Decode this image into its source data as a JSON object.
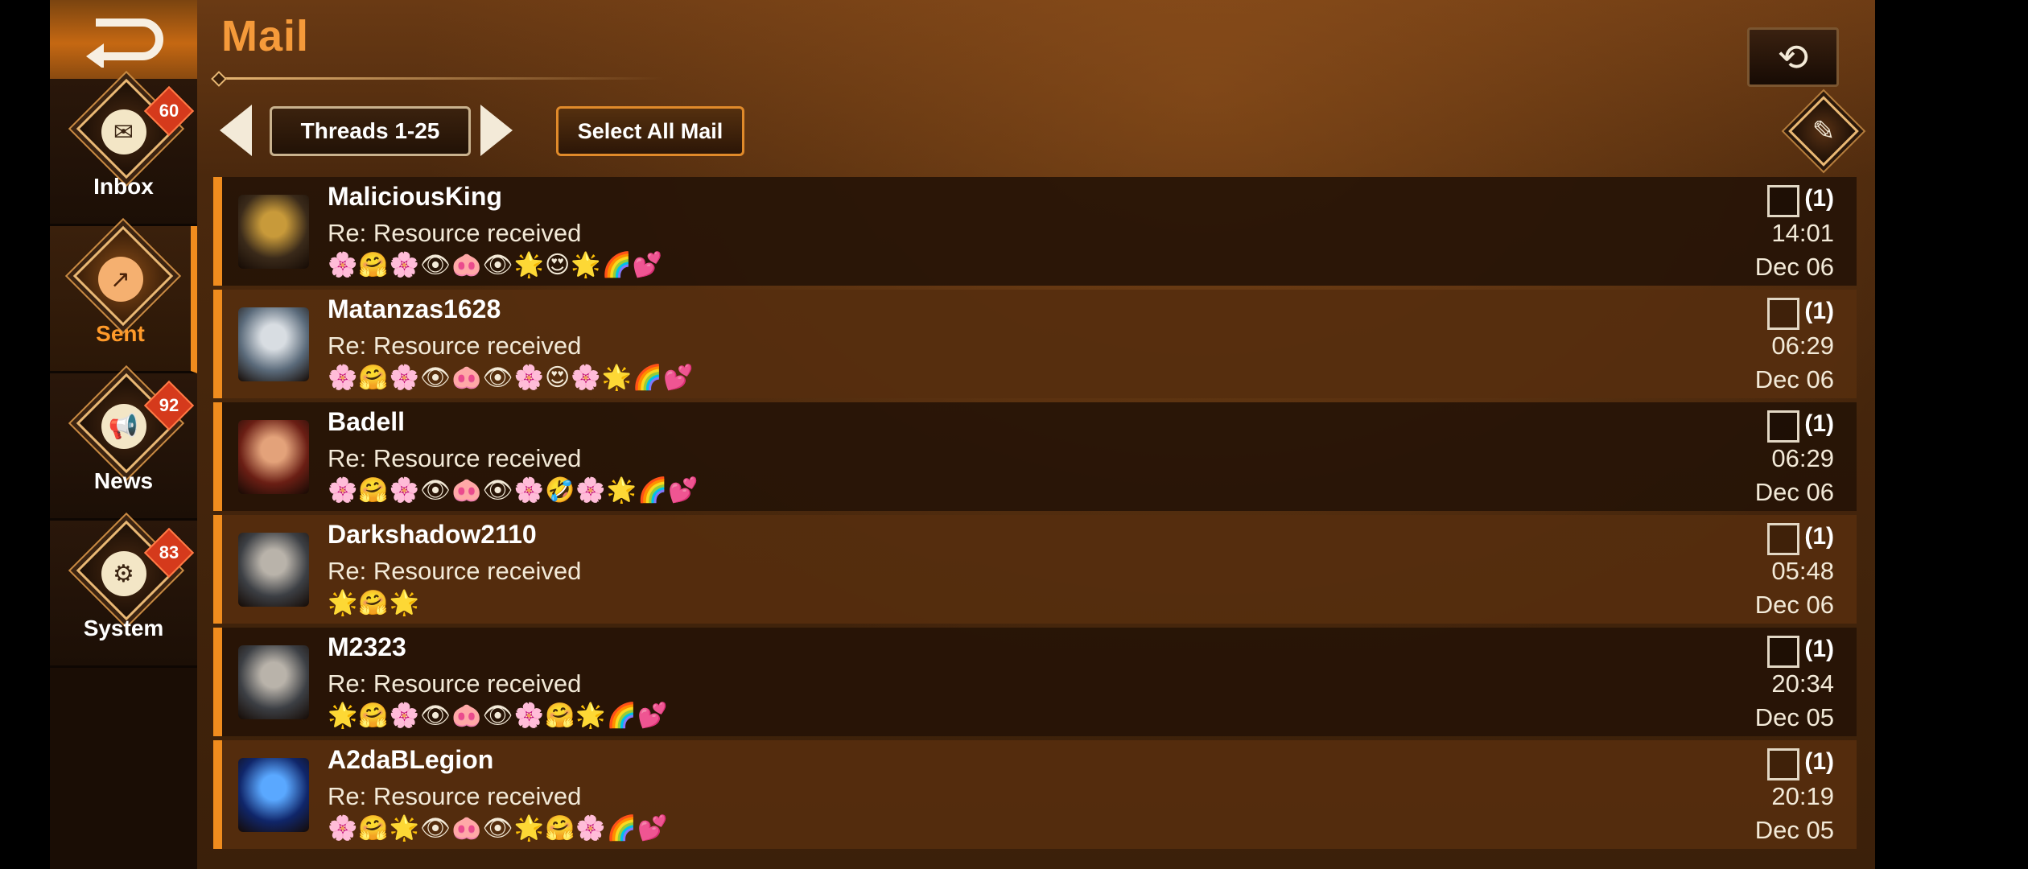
{
  "page": {
    "title": "Mail"
  },
  "nav": {
    "back_icon": "return-arrow-icon",
    "tabs": [
      {
        "label": "Inbox",
        "badge": "60",
        "icon": "envelope-icon",
        "glyph": "✉",
        "active": false
      },
      {
        "label": "Sent",
        "badge": "",
        "icon": "share-icon",
        "glyph": "↗",
        "active": true
      },
      {
        "label": "News",
        "badge": "92",
        "icon": "megaphone-icon",
        "glyph": "📢",
        "active": false
      },
      {
        "label": "System",
        "badge": "83",
        "icon": "settings-mail-icon",
        "glyph": "⚙",
        "active": false
      }
    ]
  },
  "toolbar": {
    "threads_label": "Threads 1-25",
    "select_all_label": "Select All Mail",
    "replay_icon": "replay-icon",
    "compose_icon": "compose-icon"
  },
  "mails": [
    {
      "sender": "MaliciousKing",
      "subject": "Re: Resource received",
      "preview": "🌸🤗🌸👁🐽👁🌟😍🌟🌈💕",
      "count": "(1)",
      "time": "14:01",
      "date": "Dec 06",
      "avatar_colors": [
        "#3a2a1a",
        "#c89a3a"
      ]
    },
    {
      "sender": "Matanzas1628",
      "subject": "Re: Resource received",
      "preview": "🌸🤗🌸👁🐽👁🌸😍🌸🌟🌈💕",
      "count": "(1)",
      "time": "06:29",
      "date": "Dec 06",
      "avatar_colors": [
        "#5a6a7a",
        "#d8dde2"
      ]
    },
    {
      "sender": "Badell",
      "subject": "Re: Resource received",
      "preview": "🌸🤗🌸👁🐽👁🌸🤣🌸🌟🌈💕",
      "count": "(1)",
      "time": "06:29",
      "date": "Dec 06",
      "avatar_colors": [
        "#6a1e14",
        "#e3a27a"
      ]
    },
    {
      "sender": "Darkshadow2110",
      "subject": "Re: Resource received",
      "preview": "🌟🤗🌟",
      "count": "(1)",
      "time": "05:48",
      "date": "Dec 06",
      "avatar_colors": [
        "#3c3f44",
        "#b9b3aa"
      ]
    },
    {
      "sender": "M2323",
      "subject": "Re: Resource received",
      "preview": "🌟🤗🌸👁🐽👁🌸🤗🌟🌈💕",
      "count": "(1)",
      "time": "20:34",
      "date": "Dec 05",
      "avatar_colors": [
        "#3c3f44",
        "#b9b3aa"
      ]
    },
    {
      "sender": "A2daBLegion",
      "subject": "Re: Resource received",
      "preview": "🌸🤗🌟👁🐽👁🌟🤗🌸🌈💕",
      "count": "(1)",
      "time": "20:19",
      "date": "Dec 05",
      "avatar_colors": [
        "#10266a",
        "#5aa8ff"
      ]
    }
  ],
  "colors": {
    "accent": "#f08c1e",
    "title": "#f59a3a",
    "badge": "#d53a1c"
  }
}
